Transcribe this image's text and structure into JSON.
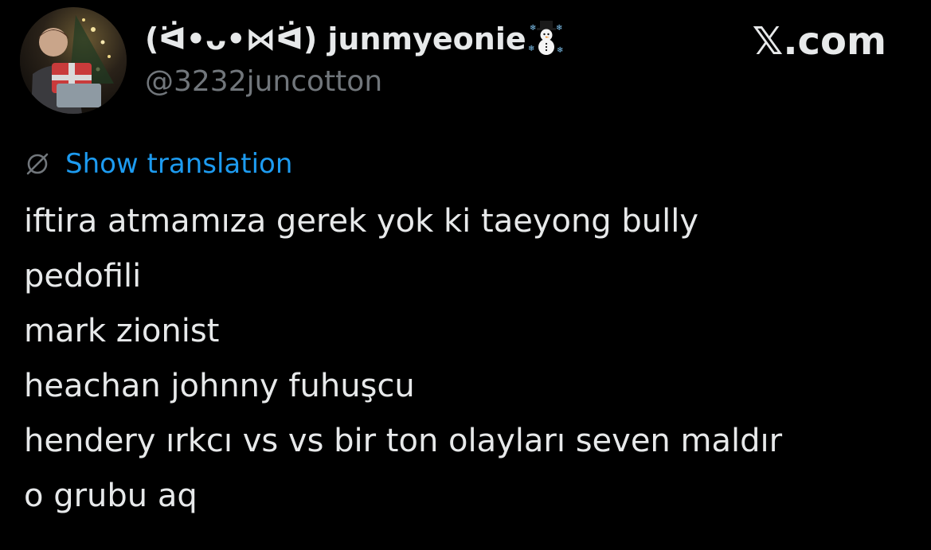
{
  "author": {
    "display_name": "(ᐛ•ᴗ•⋈ᐛ) junmyeonie",
    "name_emoji": "snowman-icon",
    "handle": "@3232juncotton"
  },
  "brand": {
    "label": "𝕏.com"
  },
  "translation": {
    "icon": "globe-icon",
    "label": "Show translation",
    "color": "#1d9bf0"
  },
  "tweet": {
    "lines": [
      "iftira atmamıza gerek yok ki taeyong bully",
      "pedofili",
      "mark zionist",
      "heachan johnny fuhuşcu",
      "hendery ırkcı vs vs bir ton olayları seven maldır",
      "o grubu aq"
    ]
  },
  "colors": {
    "background": "#000000",
    "text": "#e7e9ea",
    "muted": "#71767b",
    "link": "#1d9bf0"
  }
}
